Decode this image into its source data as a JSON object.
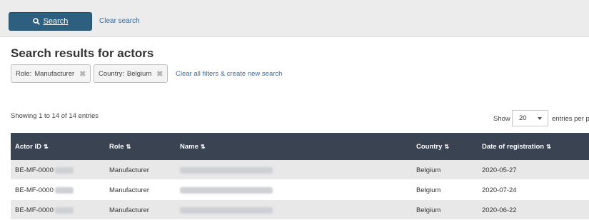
{
  "toolbar": {
    "search_label": "Search",
    "clear_search_label": "Clear search"
  },
  "page_title": "Search results for actors",
  "filters": [
    {
      "label": "Role:",
      "value": "Manufacturer"
    },
    {
      "label": "Country:",
      "value": "Belgium"
    }
  ],
  "clear_all_label": "Clear all filters & create new search",
  "summary": "Showing 1 to 14 of 14 entries",
  "pagination": {
    "show_label": "Show",
    "page_size": "20",
    "per_page_label": "entries per pa"
  },
  "table": {
    "columns": [
      {
        "label": "Actor ID"
      },
      {
        "label": "Role"
      },
      {
        "label": "Name"
      },
      {
        "label": "Country"
      },
      {
        "label": "Date of registration"
      }
    ],
    "rows": [
      {
        "actor_id": "BE-MF-0000",
        "role": "Manufacturer",
        "country": "Belgium",
        "date": "2020-05-27"
      },
      {
        "actor_id": "BE-MF-0000",
        "role": "Manufacturer",
        "country": "Belgium",
        "date": "2020-07-24"
      },
      {
        "actor_id": "BE-MF-0000",
        "role": "Manufacturer",
        "country": "Belgium",
        "date": "2020-06-22"
      }
    ]
  },
  "icons": {
    "search": "search-icon",
    "remove": "close-icon",
    "sort": "sort-icon",
    "dropdown": "chevron-down-icon"
  },
  "colors": {
    "primary_button": "#2d5f80",
    "link": "#2b6ea8",
    "table_header": "#3a4352",
    "row_alt": "#e8e8e8"
  }
}
